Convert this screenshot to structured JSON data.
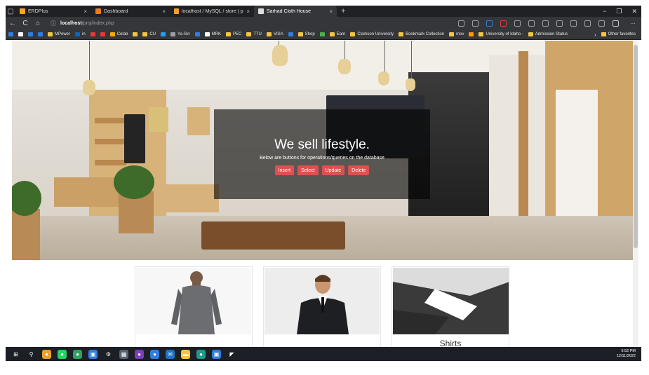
{
  "browser": {
    "tabs": [
      {
        "title": "ERDPlus",
        "color": "#f5a623",
        "active": false
      },
      {
        "title": "Dashboard",
        "color": "#e67e22",
        "active": false
      },
      {
        "title": "localhost / MySQL / store | phpM",
        "color": "#f0a030",
        "active": false
      },
      {
        "title": "Sarhad Cloth House",
        "color": "#dddddd",
        "active": true
      }
    ],
    "close_glyph": "×",
    "new_tab_glyph": "+",
    "window_controls": {
      "minimize": "−",
      "restore": "❐",
      "close": "✕"
    },
    "nav": {
      "back": "←",
      "reload": "C",
      "home": "⌂"
    },
    "url": {
      "info_icon": "ⓘ",
      "host": "localhost",
      "path": "/proj/index.php"
    },
    "extensions": [
      {
        "name": "read-aloud-icon",
        "color": "#9aa0a6"
      },
      {
        "name": "translate-icon",
        "color": "#9aa0a6"
      },
      {
        "name": "extension-blue-icon",
        "color": "#2f7de1"
      },
      {
        "name": "extension-red-icon",
        "color": "#e53935"
      },
      {
        "name": "refresh-ext-icon",
        "color": "#9aa0a6"
      },
      {
        "name": "favorites-icon",
        "color": "#9aa0a6"
      },
      {
        "name": "collections-icon",
        "color": "#9aa0a6"
      },
      {
        "name": "heart-icon",
        "color": "#9aa0a6"
      },
      {
        "name": "games-icon",
        "color": "#9aa0a6"
      },
      {
        "name": "share-icon",
        "color": "#9aa0a6"
      },
      {
        "name": "account-icon",
        "color": "#9aa0a6"
      },
      {
        "name": "profile-avatar-icon",
        "color": "#c9c9c9"
      }
    ],
    "more_glyph": "···",
    "bookmarks": [
      {
        "label": "",
        "color": "#2f7de1"
      },
      {
        "label": "",
        "color": "#ffffff"
      },
      {
        "label": "",
        "color": "#2f7de1"
      },
      {
        "label": "",
        "color": "#2f7de1"
      },
      {
        "label": "MPower",
        "color": "#f4c542"
      },
      {
        "label": "in",
        "color": "#0a66c2"
      },
      {
        "label": "",
        "color": "#e53935"
      },
      {
        "label": "",
        "color": "#e53935"
      },
      {
        "label": "Colab",
        "color": "#f9ab00"
      },
      {
        "label": "",
        "color": "#f4c542"
      },
      {
        "label": "CU",
        "color": "#f4c542"
      },
      {
        "label": "",
        "color": "#1da1f2"
      },
      {
        "label": "Ya-Sin",
        "color": "#9aa0a6"
      },
      {
        "label": "",
        "color": "#2f7de1"
      },
      {
        "label": "MRK",
        "color": "#ffffff"
      },
      {
        "label": "PEC",
        "color": "#f4c542"
      },
      {
        "label": "TTU",
        "color": "#f4c542"
      },
      {
        "label": "VISA",
        "color": "#f4c542"
      },
      {
        "label": "",
        "color": "#2f7de1"
      },
      {
        "label": "Shop",
        "color": "#f4c542"
      },
      {
        "label": "",
        "color": "#4caf50"
      },
      {
        "label": "Earn",
        "color": "#f4c542"
      },
      {
        "label": "Clarkson University",
        "color": "#f4c542"
      },
      {
        "label": "Bookmark Collection",
        "color": "#f4c542"
      },
      {
        "label": "mov",
        "color": "#f4c542"
      },
      {
        "label": "",
        "color": "#ff9800"
      },
      {
        "label": "University of Idaho -",
        "color": "#f4c542"
      },
      {
        "label": "Admission Status",
        "color": "#f4c542"
      }
    ],
    "bookmarks_more_glyph": "›",
    "other_favorites": "Other favorites"
  },
  "page": {
    "hero": {
      "heading": "We sell lifestyle.",
      "subtext": "Below are buttons for operations/queries on the database",
      "buttons": [
        "Insert",
        "Select",
        "Update",
        "Delete"
      ],
      "button_color": "#d9534f"
    },
    "cards": [
      {
        "caption": ""
      },
      {
        "caption": ""
      },
      {
        "caption": "Shirts"
      }
    ]
  },
  "taskbar": {
    "icons": [
      {
        "name": "windows-start-icon",
        "glyph": "⊞",
        "color": "#1c1f26"
      },
      {
        "name": "search-icon",
        "glyph": "⚲",
        "color": "#1c1f26"
      },
      {
        "name": "chrome-icon",
        "glyph": "●",
        "color": "#e8a22b"
      },
      {
        "name": "whatsapp-icon",
        "glyph": "●",
        "color": "#25d366"
      },
      {
        "name": "app-green-icon",
        "glyph": "●",
        "color": "#31a05f"
      },
      {
        "name": "photos-icon",
        "glyph": "▣",
        "color": "#2f7de1"
      },
      {
        "name": "settings-icon",
        "glyph": "⚙",
        "color": "#1c1f26"
      },
      {
        "name": "calculator-icon",
        "glyph": "▦",
        "color": "#5a6270"
      },
      {
        "name": "app-purple-icon",
        "glyph": "●",
        "color": "#7b3fb6"
      },
      {
        "name": "app-blue-icon",
        "glyph": "●",
        "color": "#2f7de1"
      },
      {
        "name": "mail-icon",
        "glyph": "✉",
        "color": "#1b74c9"
      },
      {
        "name": "file-explorer-icon",
        "glyph": "▬",
        "color": "#f4c542"
      },
      {
        "name": "edge-icon",
        "glyph": "●",
        "color": "#1d9b8c"
      },
      {
        "name": "app-window-icon",
        "glyph": "▣",
        "color": "#2f7de1"
      },
      {
        "name": "vscode-icon",
        "glyph": "◤",
        "color": "#1c1f26"
      }
    ],
    "time": "6:52 PM",
    "date": "12/11/2022"
  }
}
